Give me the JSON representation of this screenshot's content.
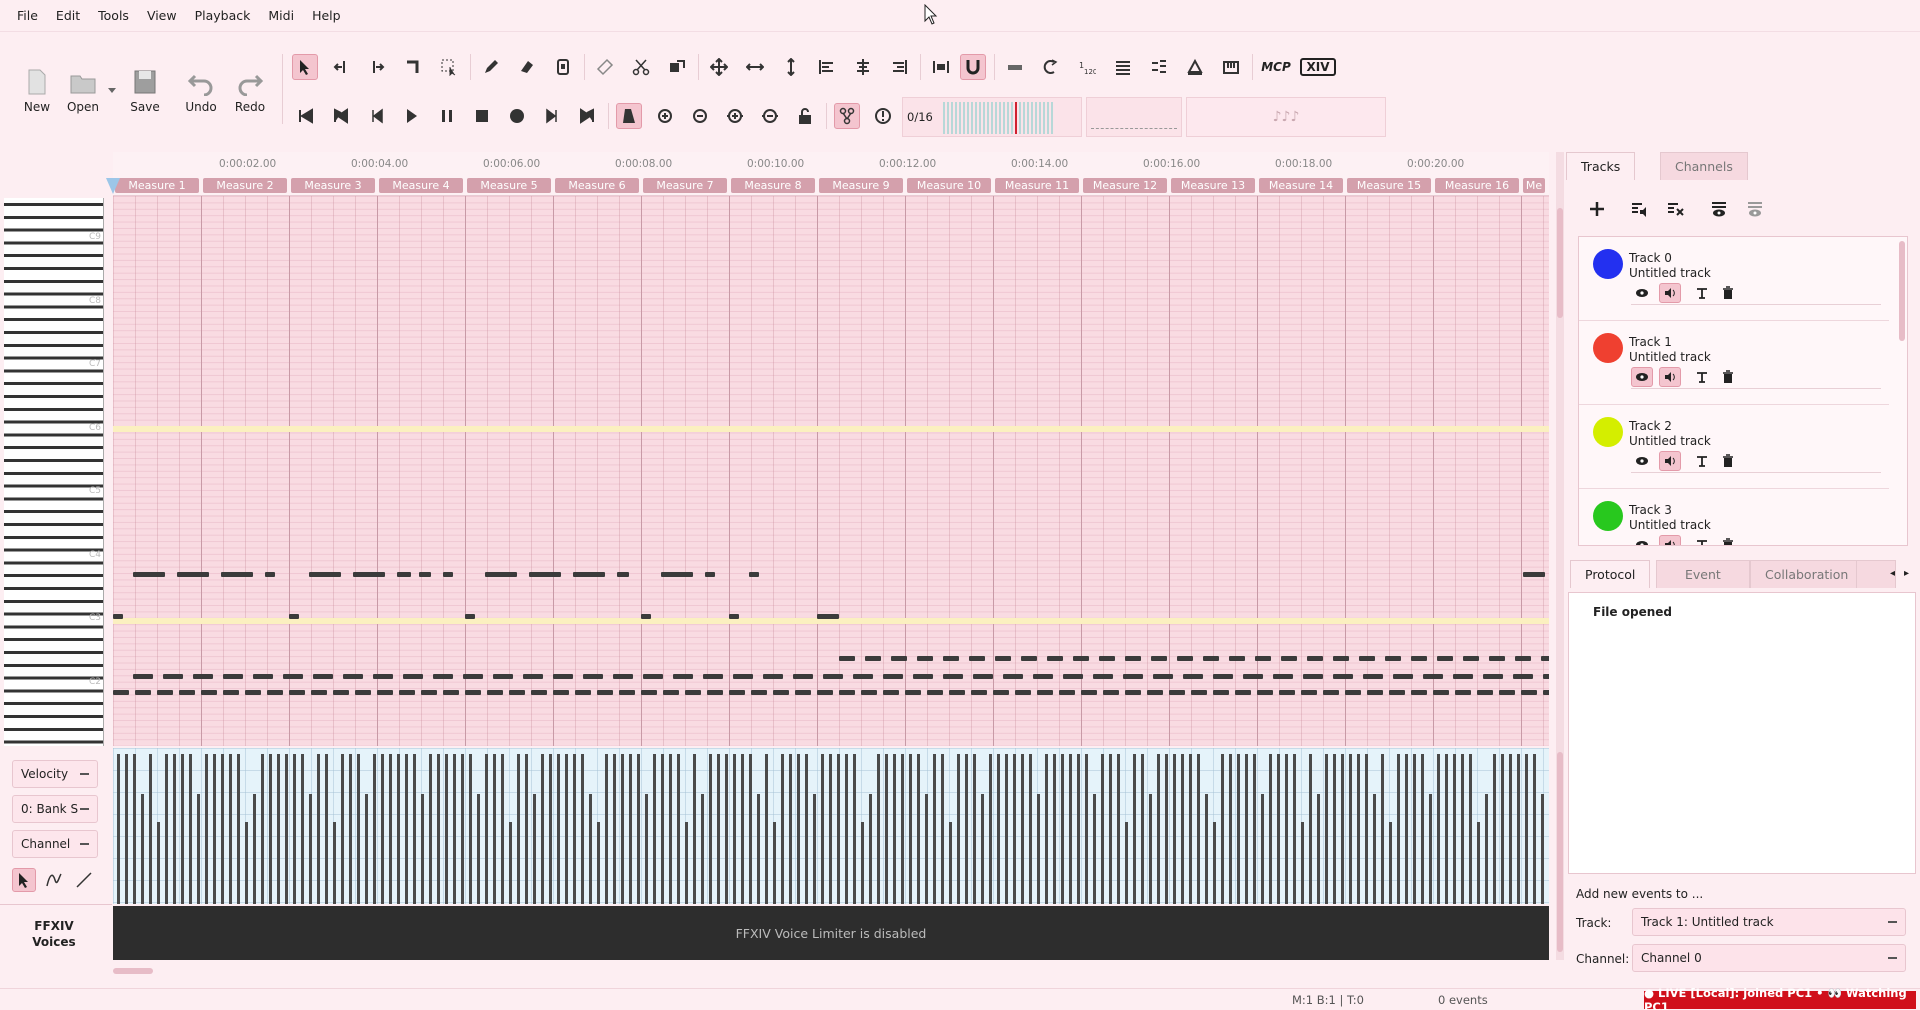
{
  "menu": [
    "File",
    "Edit",
    "Tools",
    "View",
    "Playback",
    "Midi",
    "Help"
  ],
  "toolbar": {
    "new_label": "New",
    "open_label": "Open",
    "save_label": "Save",
    "undo_label": "Undo",
    "redo_label": "Redo",
    "measure_counter": "0/16",
    "mcp_label": "MCP",
    "xiv_label": "XIV",
    "lcd3_text": "♪♪♪"
  },
  "ruler": {
    "times": [
      "0:00:02.00",
      "0:00:04.00",
      "0:00:06.00",
      "0:00:08.00",
      "0:00:10.00",
      "0:00:12.00",
      "0:00:14.00",
      "0:00:16.00",
      "0:00:18.00",
      "0:00:20.00"
    ],
    "measures": [
      "Measure 1",
      "Measure 2",
      "Measure 3",
      "Measure 4",
      "Measure 5",
      "Measure 6",
      "Measure 7",
      "Measure 8",
      "Measure 9",
      "Measure 10",
      "Measure 11",
      "Measure 12",
      "Measure 13",
      "Measure 14",
      "Measure 15",
      "Measure 16",
      "Me"
    ]
  },
  "keys": [
    "C9",
    "C8",
    "C7",
    "C6",
    "C5",
    "C4",
    "C3",
    "C2"
  ],
  "controls": {
    "velocity_label": "Velocity",
    "bank_label": "0: Bank S",
    "channel_label": "Channel",
    "voices_label": "FFXIV Voices",
    "voice_limiter_text": "FFXIV Voice Limiter is disabled"
  },
  "tabs": {
    "tracks": "Tracks",
    "channels": "Channels",
    "protocol": "Protocol",
    "event": "Event",
    "collaboration": "Collaboration"
  },
  "tracks": [
    {
      "name": "Track 0",
      "sub": "Untitled track",
      "color": "#2330f0"
    },
    {
      "name": "Track 1",
      "sub": "Untitled track",
      "color": "#ef4030"
    },
    {
      "name": "Track 2",
      "sub": "Untitled track",
      "color": "#d4ee00"
    },
    {
      "name": "Track 3",
      "sub": "Untitled track",
      "color": "#28c81e"
    }
  ],
  "protocol": {
    "entry": "File opened"
  },
  "add_events": {
    "title": "Add new events to ...",
    "track_label": "Track:",
    "track_value": "Track 1: Untitled track",
    "channel_label": "Channel:",
    "channel_value": "Channel 0"
  },
  "status": {
    "position": "M:1 B:1 | T:0",
    "events": "0 events",
    "live": "● LIVE [Local]: joined PC1 • 👀 Watching PC1"
  }
}
